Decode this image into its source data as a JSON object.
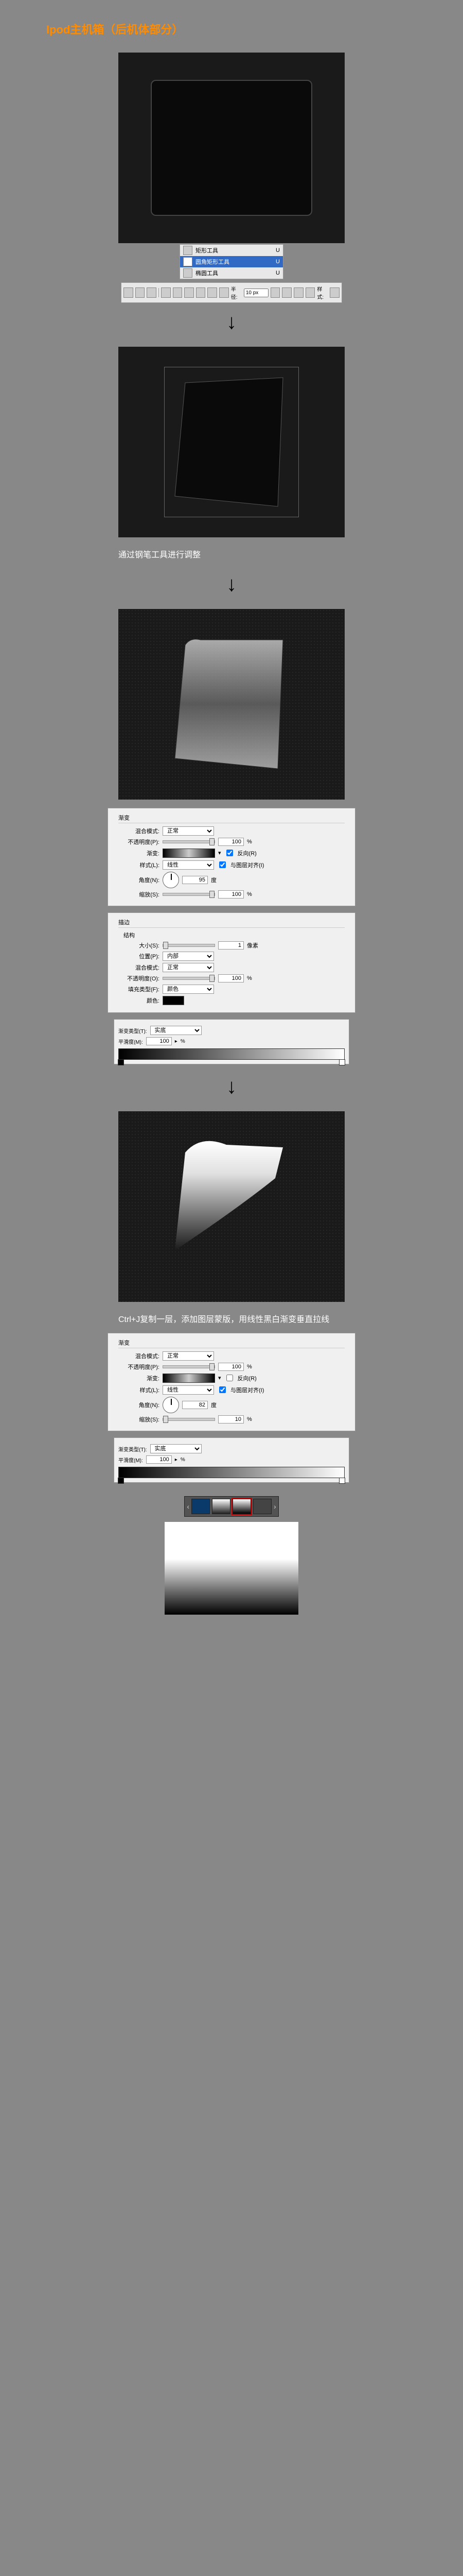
{
  "title": "Ipod主机箱（后机体部分）",
  "toolbox": {
    "items": [
      {
        "label": "矩形工具",
        "key": "U"
      },
      {
        "label": "圆角矩形工具",
        "key": "U",
        "selected": true
      },
      {
        "label": "椭圆工具",
        "key": "U"
      }
    ]
  },
  "optionsbar": {
    "radius_label": "半径:",
    "radius_value": "10 px",
    "style_label": "样式:"
  },
  "caption1": "通过钢笔工具进行调整",
  "grad_dialog1": {
    "section": "渐变",
    "blend_label": "混合模式:",
    "blend_value": "正常",
    "opacity_label": "不透明度(P):",
    "opacity_value": "100",
    "opacity_unit": "%",
    "grad_label": "渐变:",
    "reverse_label": "反向(R)",
    "style_label": "样式(L):",
    "style_value": "线性",
    "align_label": "与图层对齐(I)",
    "angle_label": "角度(N):",
    "angle_value": "95",
    "angle_unit": "度",
    "scale_label": "缩放(S):",
    "scale_value": "100",
    "scale_unit": "%"
  },
  "stroke_dialog": {
    "section": "描边",
    "struct": "结构",
    "size_label": "大小(S):",
    "size_value": "1",
    "size_unit": "像素",
    "pos_label": "位置(P):",
    "pos_value": "内部",
    "blend_label": "混合模式:",
    "blend_value": "正常",
    "opacity_label": "不透明度(O):",
    "opacity_value": "100",
    "opacity_unit": "%",
    "fill_label": "填充类型(F):",
    "fill_value": "颜色",
    "color_label": "颜色:"
  },
  "gradeditor1": {
    "type_label": "渐变类型(T):",
    "type_value": "实底",
    "smooth_label": "平滑度(M):",
    "smooth_value": "100",
    "smooth_unit": "%"
  },
  "caption2": "Ctrl+J复制一层，添加图层蒙版，用线性黑白渐变垂直拉线",
  "grad_dialog2": {
    "section": "渐变",
    "blend_label": "混合模式:",
    "blend_value": "正常",
    "opacity_label": "不透明度(P):",
    "opacity_value": "100",
    "opacity_unit": "%",
    "grad_label": "渐变:",
    "reverse_label": "反向(R)",
    "style_label": "样式(L):",
    "style_value": "线性",
    "align_label": "与图层对齐(I)",
    "angle_label": "角度(N):",
    "angle_value": "82",
    "angle_unit": "度",
    "scale_label": "缩放(S):",
    "scale_value": "10",
    "scale_unit": "%"
  },
  "gradeditor2": {
    "type_label": "渐变类型(T):",
    "type_value": "实底",
    "smooth_label": "平滑度(M):",
    "smooth_value": "100",
    "smooth_unit": "%"
  }
}
